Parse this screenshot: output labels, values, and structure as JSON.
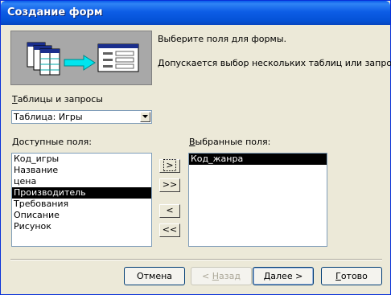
{
  "window": {
    "title": "Создание форм"
  },
  "illustration": {
    "name": "form-wizard-illustration-icon"
  },
  "info": {
    "line1": "Выберите поля для формы.",
    "line2": "Допускается выбор нескольких таблиц или запросов."
  },
  "tables": {
    "label_accel": "Т",
    "label_rest": "аблицы и запросы",
    "selected": "Таблица: Игры"
  },
  "available": {
    "label_accel": "Д",
    "label_rest": "оступные поля:",
    "items": [
      "Код_игры",
      "Название",
      "цена",
      "Производитель",
      "Требования",
      "Описание",
      "Рисунок"
    ],
    "selected_index": 3
  },
  "chosen": {
    "label_accel": "В",
    "label_rest": "ыбранные поля:",
    "items": [
      "Код_жанра"
    ],
    "selected_index": 0
  },
  "move_buttons": {
    "add_one": ">",
    "add_all": ">>",
    "remove_one": "<",
    "remove_all": "<<"
  },
  "footer": {
    "cancel": "Отмена",
    "back_prefix": "< ",
    "back_accel": "Н",
    "back_rest": "азад",
    "next_accel": "Д",
    "next_rest": "алее >",
    "finish_accel": "Г",
    "finish_rest": "отово"
  }
}
